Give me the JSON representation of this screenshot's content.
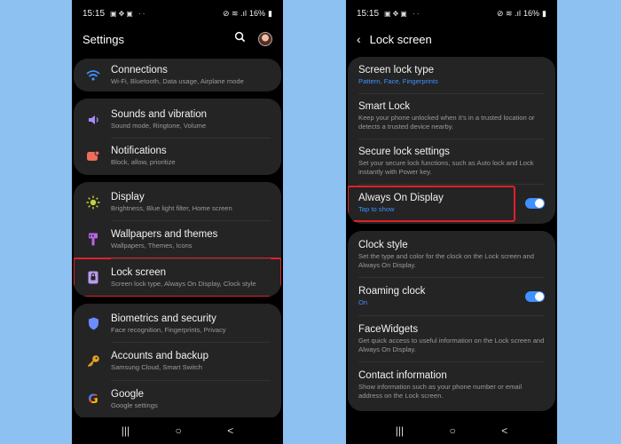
{
  "status": {
    "time": "15:15",
    "battery": "16%"
  },
  "left": {
    "title": "Settings",
    "groups": [
      [
        {
          "icon": "wifi-icon",
          "title": "Connections",
          "sub": "Wi-Fi, Bluetooth, Data usage, Airplane mode"
        }
      ],
      [
        {
          "icon": "speaker-icon",
          "title": "Sounds and vibration",
          "sub": "Sound mode, Ringtone, Volume"
        },
        {
          "icon": "notification-icon",
          "title": "Notifications",
          "sub": "Block, allow, prioritize"
        }
      ],
      [
        {
          "icon": "brightness-icon",
          "title": "Display",
          "sub": "Brightness, Blue light filter, Home screen"
        },
        {
          "icon": "brush-icon",
          "title": "Wallpapers and themes",
          "sub": "Wallpapers, Themes, Icons"
        },
        {
          "icon": "lock-icon",
          "title": "Lock screen",
          "sub": "Screen lock type, Always On Display, Clock style"
        }
      ],
      [
        {
          "icon": "shield-icon",
          "title": "Biometrics and security",
          "sub": "Face recognition, Fingerprints, Privacy"
        },
        {
          "icon": "key-icon",
          "title": "Accounts and backup",
          "sub": "Samsung Cloud, Smart Switch"
        },
        {
          "icon": "google-icon",
          "title": "Google",
          "sub": "Google settings"
        }
      ]
    ]
  },
  "right": {
    "title": "Lock screen",
    "groups": [
      [
        {
          "title": "Screen lock type",
          "sub": "Pattern, Face, Fingerprints",
          "blue": true
        },
        {
          "title": "Smart Lock",
          "sub": "Keep your phone unlocked when it's in a trusted location or detects a trusted device nearby."
        },
        {
          "title": "Secure lock settings",
          "sub": "Set your secure lock functions, such as Auto lock and Lock instantly with Power key."
        },
        {
          "title": "Always On Display",
          "sub": "Tap to show",
          "blue": true,
          "toggle": true
        }
      ],
      [
        {
          "title": "Clock style",
          "sub": "Set the type and color for the clock on the Lock screen and Always On Display."
        },
        {
          "title": "Roaming clock",
          "sub": "On",
          "blue": true,
          "toggle": true
        },
        {
          "title": "FaceWidgets",
          "sub": "Get quick access to useful information on the Lock screen and Always On Display."
        },
        {
          "title": "Contact information",
          "sub": "Show information such as your phone number or email address on the Lock screen."
        }
      ]
    ]
  },
  "nav": {
    "recents": "|||",
    "home": "○",
    "back": "<"
  },
  "colors": {
    "accent": "#3e91ff",
    "highlight": "#e0202a",
    "card": "#242424",
    "background": "#8dc1f2"
  }
}
